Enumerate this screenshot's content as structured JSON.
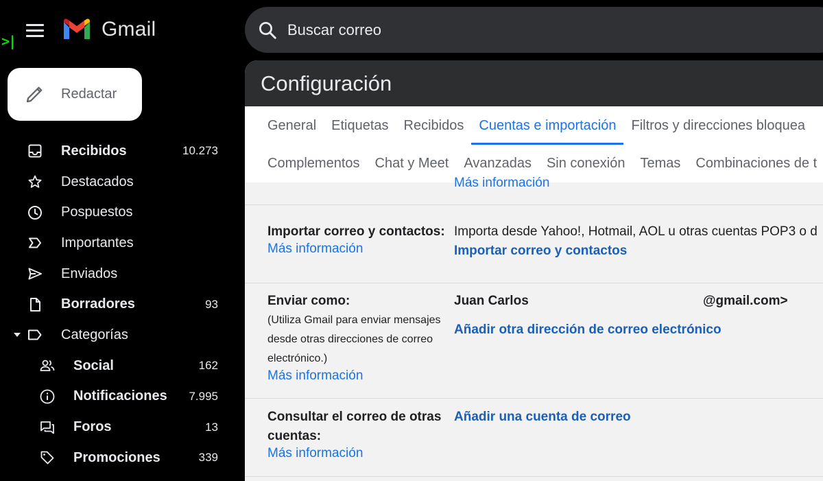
{
  "app": {
    "logo_text": "Gmail",
    "search_placeholder": "Buscar correo",
    "compose_label": "Redactar"
  },
  "sidebar": {
    "items": [
      {
        "label": "Recibidos",
        "count": "10.273",
        "icon": "inbox-icon",
        "bold": true
      },
      {
        "label": "Destacados",
        "count": "",
        "icon": "star-icon",
        "bold": false
      },
      {
        "label": "Pospuestos",
        "count": "",
        "icon": "clock-icon",
        "bold": false
      },
      {
        "label": "Importantes",
        "count": "",
        "icon": "label-important-icon",
        "bold": false
      },
      {
        "label": "Enviados",
        "count": "",
        "icon": "send-icon",
        "bold": false
      },
      {
        "label": "Borradores",
        "count": "93",
        "icon": "draft-icon",
        "bold": true
      },
      {
        "label": "Categorías",
        "count": "",
        "icon": "label-icon",
        "bold": false
      },
      {
        "label": "Social",
        "count": "162",
        "icon": "people-icon",
        "bold": true
      },
      {
        "label": "Notificaciones",
        "count": "7.995",
        "icon": "info-icon",
        "bold": true
      },
      {
        "label": "Foros",
        "count": "13",
        "icon": "forum-icon",
        "bold": true
      },
      {
        "label": "Promociones",
        "count": "339",
        "icon": "tag-icon",
        "bold": true
      }
    ]
  },
  "settings": {
    "title": "Configuración",
    "tabs_row1": [
      "General",
      "Etiquetas",
      "Recibidos",
      "Cuentas e importación",
      "Filtros y direcciones bloquea"
    ],
    "tabs_row2": [
      "Complementos",
      "Chat y Meet",
      "Avanzadas",
      "Sin conexión",
      "Temas",
      "Combinaciones de t"
    ],
    "active_tab": "Cuentas e importación",
    "top_link": "Más información",
    "rows": {
      "import": {
        "title": "Importar correo y contactos:",
        "more": "Más información",
        "desc": "Importa desde Yahoo!, Hotmail, AOL u otras cuentas POP3 o d",
        "action": "Importar correo y contactos"
      },
      "send_as": {
        "title": "Enviar como:",
        "note": "(Utiliza Gmail para enviar mensajes desde otras direcciones de correo electrónico.)",
        "more": "Más información",
        "name": "Juan Carlos",
        "email": "@gmail.com>",
        "action": "Añadir otra dirección de correo electrónico"
      },
      "check_mail": {
        "title": "Consultar el correo de otras cuentas:",
        "more": "Más información",
        "action": "Añadir una cuenta de correo"
      }
    }
  },
  "colors": {
    "accent": "#1a73e8",
    "panel_header": "#2d2e30",
    "panel_bg": "#f2f2f2",
    "search_bg": "#303134"
  }
}
